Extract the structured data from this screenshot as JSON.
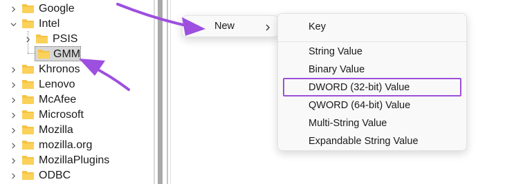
{
  "tree": {
    "items": [
      {
        "label": "Google",
        "expanded": false
      },
      {
        "label": "Intel",
        "expanded": true
      },
      {
        "label": "PSIS",
        "expanded": false
      },
      {
        "label": "GMM",
        "expanded": false,
        "selected": true
      },
      {
        "label": "Khronos",
        "expanded": false
      },
      {
        "label": "Lenovo",
        "expanded": false
      },
      {
        "label": "McAfee",
        "expanded": false
      },
      {
        "label": "Microsoft",
        "expanded": false
      },
      {
        "label": "Mozilla",
        "expanded": false
      },
      {
        "label": "mozilla.org",
        "expanded": false
      },
      {
        "label": "MozillaPlugins",
        "expanded": false
      },
      {
        "label": "ODBC",
        "expanded": false
      }
    ]
  },
  "context_menu": {
    "new_label": "New",
    "submenu_chevron_icon": "chevron-right-icon"
  },
  "submenu": {
    "items": [
      {
        "label": "Key"
      },
      {
        "label": "String Value"
      },
      {
        "label": "Binary Value"
      },
      {
        "label": "DWORD (32-bit) Value",
        "highlighted": true
      },
      {
        "label": "QWORD (64-bit) Value"
      },
      {
        "label": "Multi-String Value"
      },
      {
        "label": "Expandable String Value"
      }
    ]
  },
  "colors": {
    "folder": "#f6c343",
    "highlight": "#9b4fd8",
    "annotation_arrow": "#9d4fe0"
  }
}
